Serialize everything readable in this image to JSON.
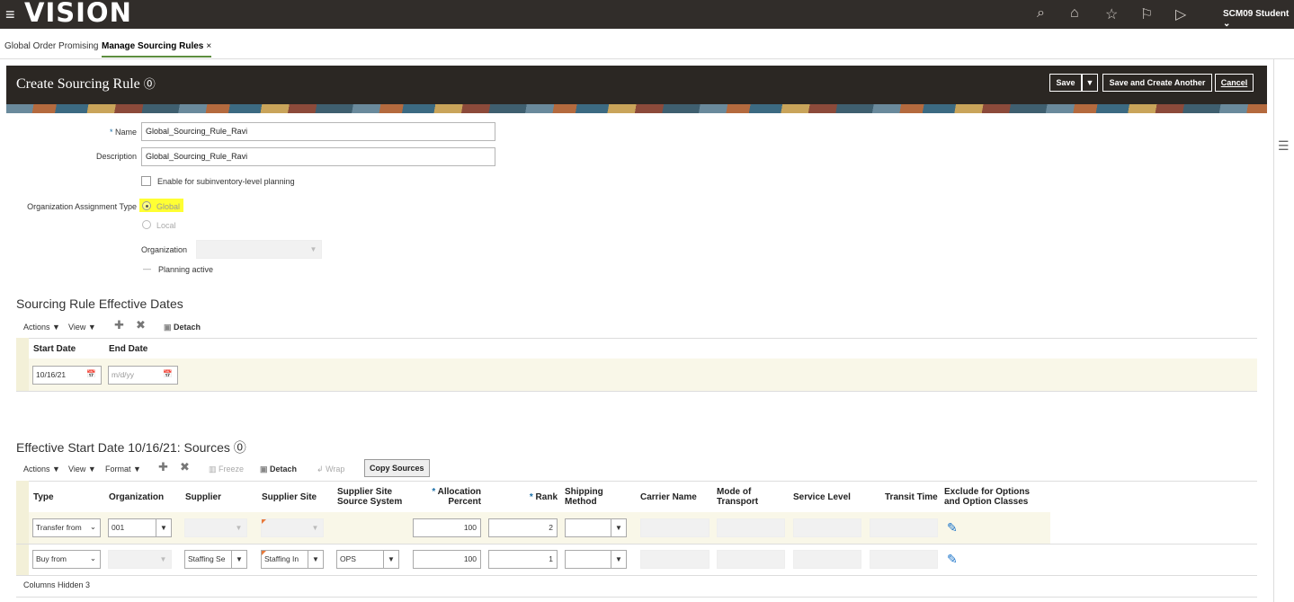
{
  "app": {
    "logo": "VISION",
    "user": "SCM09 Student"
  },
  "tabs": [
    {
      "label": "Global Order Promising"
    },
    {
      "label": "Manage Sourcing Rules",
      "close": "×"
    }
  ],
  "header": {
    "title": "Create Sourcing Rule",
    "save": "Save",
    "save_another": "Save and Create Another",
    "cancel": "Cancel"
  },
  "form": {
    "name_label": "Name",
    "name_value": "Global_Sourcing_Rule_Ravi",
    "description_label": "Description",
    "description_value": "Global_Sourcing_Rule_Ravi",
    "subinventory_label": "Enable for subinventory-level planning",
    "org_assign_label": "Organization Assignment Type",
    "global_label": "Global",
    "local_label": "Local",
    "organization_label": "Organization",
    "planning_active": "Planning active"
  },
  "dates_section": {
    "title": "Sourcing Rule Effective Dates",
    "actions": "Actions",
    "view": "View",
    "detach": "Detach",
    "col_start": "Start Date",
    "col_end": "End Date",
    "start_value": "10/16/21",
    "end_placeholder": "m/d/yy"
  },
  "sources_section": {
    "title": "Effective Start Date 10/16/21: Sources",
    "actions": "Actions",
    "view": "View",
    "format": "Format",
    "freeze": "Freeze",
    "detach": "Detach",
    "wrap": "Wrap",
    "copy_sources": "Copy Sources",
    "columns": {
      "type": "Type",
      "organization": "Organization",
      "supplier": "Supplier",
      "supplier_site": "Supplier Site",
      "source_system_1": "Supplier Site",
      "source_system_2": "Source System",
      "allocation_1": "Allocation",
      "allocation_2": "Percent",
      "rank": "Rank",
      "shipping_1": "Shipping",
      "shipping_2": "Method",
      "carrier": "Carrier Name",
      "mode_1": "Mode of",
      "mode_2": "Transport",
      "service": "Service Level",
      "transit": "Transit Time",
      "exclude_1": "Exclude for Options",
      "exclude_2": "and Option Classes"
    },
    "rows": [
      {
        "type": "Transfer from",
        "organization": "001",
        "supplier": "",
        "supplier_site": "",
        "source_system": "",
        "allocation": "100",
        "rank": "2"
      },
      {
        "type": "Buy from",
        "organization": "",
        "supplier": "Staffing Se",
        "supplier_site": "Staffing In",
        "source_system": "OPS",
        "allocation": "100",
        "rank": "1"
      }
    ],
    "columns_hidden": "Columns Hidden  3"
  }
}
